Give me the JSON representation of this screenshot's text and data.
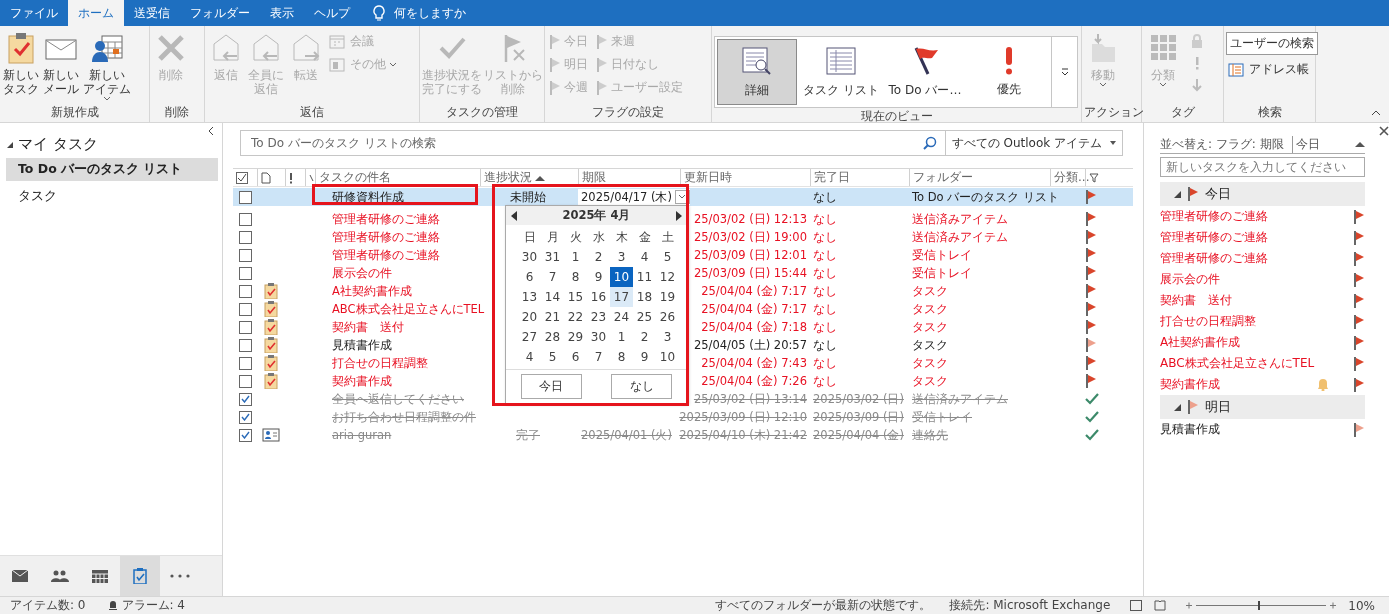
{
  "ribbon": {
    "tabs": [
      {
        "label": "ファイル",
        "selected": false
      },
      {
        "label": "ホーム",
        "selected": true
      },
      {
        "label": "送受信",
        "selected": false
      },
      {
        "label": "フォルダー",
        "selected": false
      },
      {
        "label": "表示",
        "selected": false
      },
      {
        "label": "ヘルプ",
        "selected": false
      }
    ],
    "tell_me": "何をしますか",
    "groups": [
      {
        "label": "新規作成",
        "buttons": [
          {
            "kind": "large",
            "lines": [
              "新しい",
              "タスク"
            ],
            "disabled": false,
            "dropdown": false
          },
          {
            "kind": "large",
            "lines": [
              "新しい",
              "メール"
            ],
            "disabled": false,
            "dropdown": false
          },
          {
            "kind": "large",
            "lines": [
              "新しい",
              "アイテム"
            ],
            "disabled": false,
            "dropdown": true
          }
        ]
      },
      {
        "label": "削除",
        "buttons": [
          {
            "kind": "large",
            "lines": [
              "削除"
            ],
            "disabled": true,
            "dropdown": false
          }
        ]
      },
      {
        "label": "返信",
        "buttons": [
          {
            "kind": "large",
            "lines": [
              "返信"
            ],
            "disabled": true,
            "dropdown": false
          },
          {
            "kind": "large",
            "lines": [
              "全員に",
              "返信"
            ],
            "disabled": true,
            "dropdown": false
          },
          {
            "kind": "large",
            "lines": [
              "転送"
            ],
            "disabled": true,
            "dropdown": false
          },
          {
            "kind": "small",
            "lines": [
              "会議"
            ],
            "disabled": true,
            "dropdown": false
          },
          {
            "kind": "small",
            "lines": [
              "その他"
            ],
            "disabled": true,
            "dropdown": true
          }
        ]
      },
      {
        "label": "タスクの管理",
        "buttons": [
          {
            "kind": "large",
            "lines": [
              "進捗状況を",
              "完了にする"
            ],
            "disabled": true,
            "dropdown": false
          },
          {
            "kind": "large",
            "lines": [
              "リストから",
              "削除"
            ],
            "disabled": true,
            "dropdown": false
          }
        ]
      },
      {
        "label": "フラグの設定",
        "buttons": [
          {
            "kind": "small",
            "lines": [
              "今日"
            ],
            "disabled": true,
            "dropdown": false
          },
          {
            "kind": "small",
            "lines": [
              "明日"
            ],
            "disabled": true,
            "dropdown": false
          },
          {
            "kind": "small",
            "lines": [
              "今週"
            ],
            "disabled": true,
            "dropdown": false
          },
          {
            "kind": "small",
            "lines": [
              "来週"
            ],
            "disabled": true,
            "dropdown": false
          },
          {
            "kind": "small",
            "lines": [
              "日付なし"
            ],
            "disabled": true,
            "dropdown": false
          },
          {
            "kind": "small",
            "lines": [
              "ユーザー設定"
            ],
            "disabled": true,
            "dropdown": false
          }
        ]
      },
      {
        "label": "現在のビュー",
        "buttons": [
          {
            "kind": "view",
            "lines": [
              "詳細"
            ],
            "selected": true
          },
          {
            "kind": "view",
            "lines": [
              "タスク リスト"
            ],
            "selected": false
          },
          {
            "kind": "view",
            "lines": [
              "To Do バー…"
            ],
            "selected": false
          },
          {
            "kind": "view",
            "lines": [
              "優先"
            ],
            "selected": false
          }
        ]
      },
      {
        "label": "アクション",
        "buttons": [
          {
            "kind": "large",
            "lines": [
              "移動"
            ],
            "disabled": true,
            "dropdown": true
          }
        ]
      },
      {
        "label": "タグ",
        "buttons": [
          {
            "kind": "large",
            "lines": [
              "分類"
            ],
            "disabled": true,
            "dropdown": true
          },
          {
            "kind": "icons"
          }
        ]
      },
      {
        "label": "検索",
        "buttons": [
          {
            "kind": "field",
            "lines": [
              "ユーザーの検索"
            ]
          },
          {
            "kind": "small",
            "lines": [
              "アドレス帳"
            ],
            "disabled": false,
            "dropdown": false
          }
        ]
      }
    ]
  },
  "nav": {
    "title": "マイ タスク",
    "items": [
      {
        "label": "To Do バーのタスク リスト",
        "selected": true
      },
      {
        "label": "タスク",
        "selected": false
      }
    ]
  },
  "search": {
    "placeholder": "To Do バーのタスク リストの検索",
    "scope": "すべての Outlook アイテム"
  },
  "table": {
    "columns": [
      "タスクの件名",
      "進捗状況",
      "期限",
      "更新日時",
      "完了日",
      "フォルダー",
      "分類..."
    ],
    "rows": [
      {
        "selected": true,
        "checked": false,
        "kind": "plain",
        "subject": "研修資料作成",
        "status": "未開始",
        "due": "2025/04/17 (木)",
        "completed": "なし",
        "folder": "To Do バーのタスク リスト",
        "overdue": false,
        "flag_today": true
      },
      {
        "selected": false,
        "checked": false,
        "kind": "flagged-mail",
        "subject": "管理者研修のご連絡",
        "modified": "25/03/02 (日) 12:13",
        "completed": "なし",
        "folder": "送信済みアイテム",
        "overdue": true,
        "flag_today": true
      },
      {
        "selected": false,
        "checked": false,
        "kind": "flagged-mail",
        "subject": "管理者研修のご連絡",
        "modified": "25/03/02 (日) 19:00",
        "completed": "なし",
        "folder": "送信済みアイテム",
        "overdue": true,
        "flag_today": true
      },
      {
        "selected": false,
        "checked": false,
        "kind": "plain",
        "subject": "管理者研修のご連絡",
        "modified": "25/03/09 (日) 12:01",
        "completed": "なし",
        "folder": "受信トレイ",
        "overdue": true,
        "flag_today": true
      },
      {
        "selected": false,
        "checked": false,
        "kind": "plain",
        "subject": "展示会の件",
        "modified": "25/03/09 (日) 15:44",
        "completed": "なし",
        "folder": "受信トレイ",
        "overdue": true,
        "flag_today": true
      },
      {
        "selected": false,
        "checked": false,
        "kind": "task",
        "subject": "A社契約書作成",
        "modified": "25/04/04 (金) 7:17",
        "completed": "なし",
        "folder": "タスク",
        "overdue": true,
        "flag_today": true
      },
      {
        "selected": false,
        "checked": false,
        "kind": "task",
        "subject": "ABC株式会社足立さんにTEL",
        "modified": "25/04/04 (金) 7:17",
        "completed": "なし",
        "folder": "タスク",
        "overdue": true,
        "flag_today": true
      },
      {
        "selected": false,
        "checked": false,
        "kind": "task",
        "subject": "契約書　送付",
        "modified": "25/04/04 (金) 7:18",
        "completed": "なし",
        "folder": "タスク",
        "overdue": true,
        "flag_today": true
      },
      {
        "selected": false,
        "checked": false,
        "kind": "task",
        "subject": "見積書作成",
        "modified": "25/04/05 (土) 20:57",
        "completed": "なし",
        "folder": "タスク",
        "overdue": false,
        "flag_today": false
      },
      {
        "selected": false,
        "checked": false,
        "kind": "task",
        "subject": "打合せの日程調整",
        "modified": "25/04/04 (金) 7:43",
        "completed": "なし",
        "folder": "タスク",
        "overdue": true,
        "flag_today": true
      },
      {
        "selected": false,
        "checked": false,
        "kind": "task",
        "subject": "契約書作成",
        "modified": "25/04/04 (金) 7:26",
        "completed": "なし",
        "folder": "タスク",
        "overdue": true,
        "flag_today": true
      },
      {
        "selected": false,
        "checked": true,
        "kind": "flagged-mail",
        "subject": "全員へ返信してください",
        "modified": "25/03/02 (日) 13:14",
        "completed": "2025/03/02 (日)",
        "folder": "送信済みアイテム"
      },
      {
        "selected": false,
        "checked": true,
        "kind": "plain",
        "subject": "お打ち合わせ日程調整の件",
        "modified": "2025/03/09 (日) 12:10",
        "completed": "2025/03/09 (日)",
        "folder": "受信トレイ"
      },
      {
        "selected": false,
        "checked": true,
        "kind": "contact",
        "subject": "aria guran",
        "status": "完了",
        "due": "2025/04/01 (火)",
        "modified": "2025/04/10 (木) 21:42",
        "completed": "2025/04/04 (金)",
        "folder": "連絡先"
      }
    ]
  },
  "calendar": {
    "month": "2025年 4月",
    "weekdays": [
      "日",
      "月",
      "火",
      "水",
      "木",
      "金",
      "土"
    ],
    "weeks": [
      [
        {
          "day": "30",
          "today": false,
          "selected": false
        },
        {
          "day": "31",
          "today": false,
          "selected": false
        },
        {
          "day": "1",
          "today": false,
          "selected": false
        },
        {
          "day": "2",
          "today": false,
          "selected": false
        },
        {
          "day": "3",
          "today": false,
          "selected": false
        },
        {
          "day": "4",
          "today": false,
          "selected": false
        },
        {
          "day": "5",
          "today": false,
          "selected": false
        }
      ],
      [
        {
          "day": "6",
          "today": false,
          "selected": false
        },
        {
          "day": "7",
          "today": false,
          "selected": false
        },
        {
          "day": "8",
          "today": false,
          "selected": false
        },
        {
          "day": "9",
          "today": false,
          "selected": false
        },
        {
          "day": "10",
          "today": true,
          "selected": false
        },
        {
          "day": "11",
          "today": false,
          "selected": false
        },
        {
          "day": "12",
          "today": false,
          "selected": false
        }
      ],
      [
        {
          "day": "13",
          "today": false,
          "selected": false
        },
        {
          "day": "14",
          "today": false,
          "selected": false
        },
        {
          "day": "15",
          "today": false,
          "selected": false
        },
        {
          "day": "16",
          "today": false,
          "selected": false
        },
        {
          "day": "17",
          "today": false,
          "selected": true
        },
        {
          "day": "18",
          "today": false,
          "selected": false
        },
        {
          "day": "19",
          "today": false,
          "selected": false
        }
      ],
      [
        {
          "day": "20",
          "today": false,
          "selected": false
        },
        {
          "day": "21",
          "today": false,
          "selected": false
        },
        {
          "day": "22",
          "today": false,
          "selected": false
        },
        {
          "day": "23",
          "today": false,
          "selected": false
        },
        {
          "day": "24",
          "today": false,
          "selected": false
        },
        {
          "day": "25",
          "today": false,
          "selected": false
        },
        {
          "day": "26",
          "today": false,
          "selected": false
        }
      ],
      [
        {
          "day": "27",
          "today": false,
          "selected": false
        },
        {
          "day": "28",
          "today": false,
          "selected": false
        },
        {
          "day": "29",
          "today": false,
          "selected": false
        },
        {
          "day": "30",
          "today": false,
          "selected": false
        },
        {
          "day": "1",
          "today": false,
          "selected": false
        },
        {
          "day": "2",
          "today": false,
          "selected": false
        },
        {
          "day": "3",
          "today": false,
          "selected": false
        }
      ],
      [
        {
          "day": "4",
          "today": false,
          "selected": false
        },
        {
          "day": "5",
          "today": false,
          "selected": false
        },
        {
          "day": "6",
          "today": false,
          "selected": false
        },
        {
          "day": "7",
          "today": false,
          "selected": false
        },
        {
          "day": "8",
          "today": false,
          "selected": false
        },
        {
          "day": "9",
          "today": false,
          "selected": false
        },
        {
          "day": "10",
          "today": false,
          "selected": false
        }
      ]
    ],
    "buttons": [
      "今日",
      "なし"
    ]
  },
  "todo": {
    "sort_label": "並べ替え: フラグ: 期限",
    "sort_value": "今日",
    "placeholder": "新しいタスクを入力してください",
    "groups": [
      {
        "label": "今日",
        "expanded": true,
        "flag_today": true,
        "items": [
          {
            "text": "管理者研修のご連絡",
            "overdue": true,
            "reminder": false
          },
          {
            "text": "管理者研修のご連絡",
            "overdue": true,
            "reminder": false
          },
          {
            "text": "管理者研修のご連絡",
            "overdue": true,
            "reminder": false
          },
          {
            "text": "展示会の件",
            "overdue": true,
            "reminder": false
          },
          {
            "text": "契約書　送付",
            "overdue": true,
            "reminder": false
          },
          {
            "text": "打合せの日程調整",
            "overdue": true,
            "reminder": false
          },
          {
            "text": "A社契約書作成",
            "overdue": true,
            "reminder": false
          },
          {
            "text": "ABC株式会社足立さんにTEL",
            "overdue": true,
            "reminder": false
          },
          {
            "text": "契約書作成",
            "overdue": true,
            "reminder": true
          }
        ]
      },
      {
        "label": "明日",
        "expanded": true,
        "flag_today": false,
        "items": [
          {
            "text": "見積書作成",
            "overdue": false,
            "reminder": false
          }
        ]
      }
    ]
  },
  "status_bar": {
    "items": "アイテム数: 0",
    "alarms": "アラーム: 4",
    "sync": "すべてのフォルダーが最新の状態です。",
    "connection": "接続先: Microsoft Exchange",
    "zoom": "10%"
  }
}
